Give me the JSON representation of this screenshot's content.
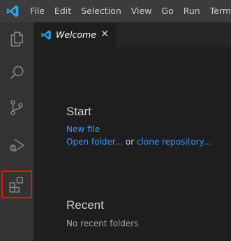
{
  "menu": [
    "File",
    "Edit",
    "Selection",
    "View",
    "Go",
    "Run",
    "Termi"
  ],
  "activity_icons": [
    "explorer-icon",
    "search-icon",
    "source-control-icon",
    "run-debug-icon",
    "extensions-icon"
  ],
  "tab": {
    "label": "Welcome",
    "close": "✕"
  },
  "welcome": {
    "start_heading": "Start",
    "new_file": "New file",
    "open_folder": "Open folder...",
    "or": " or ",
    "clone": "clone repository...",
    "recent_heading": "Recent",
    "no_recent": "No recent folders"
  },
  "colors": {
    "accent_link": "#3794ff",
    "highlight": "#e51400",
    "vscode_blue": "#23a9f2"
  }
}
